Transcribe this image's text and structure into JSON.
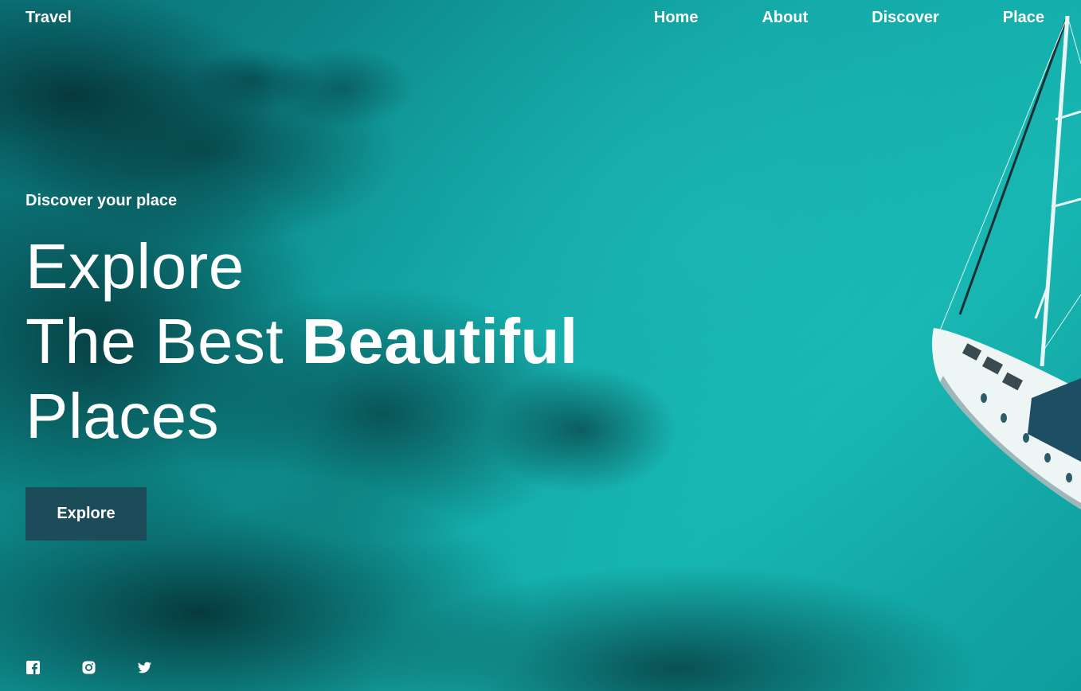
{
  "brand": "Travel",
  "nav": {
    "items": [
      {
        "label": "Home"
      },
      {
        "label": "About"
      },
      {
        "label": "Discover"
      },
      {
        "label": "Place"
      }
    ]
  },
  "hero": {
    "kicker": "Discover your place",
    "line1": "Explore",
    "line2_regular": "The Best",
    "line2_bold": "Beautiful",
    "line3": "Places",
    "cta_label": "Explore"
  },
  "socials": [
    {
      "icon": "facebook-icon"
    },
    {
      "icon": "instagram-icon"
    },
    {
      "icon": "twitter-icon"
    }
  ],
  "colors": {
    "sea": "#0f9c9c",
    "deep_water": "#04282c",
    "button": "#1c4b5a",
    "text": "#ffffff"
  }
}
